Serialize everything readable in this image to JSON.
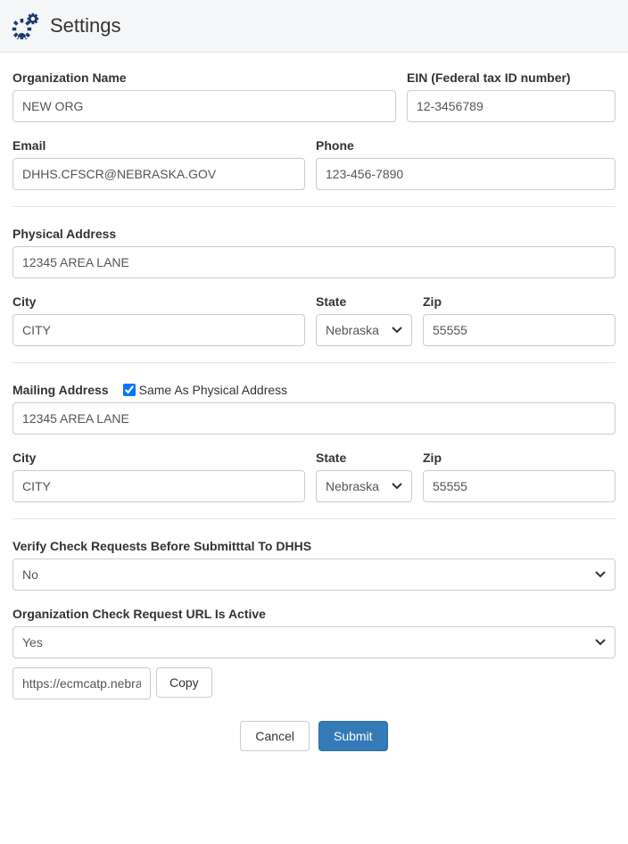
{
  "header": {
    "title": "Settings",
    "icon": "gears-icon"
  },
  "fields": {
    "org_name": {
      "label": "Organization Name",
      "value": "NEW ORG"
    },
    "ein": {
      "label": "EIN (Federal tax ID number)",
      "value": "12-3456789"
    },
    "email": {
      "label": "Email",
      "value": "DHHS.CFSCR@NEBRASKA.GOV"
    },
    "phone": {
      "label": "Phone",
      "value": "123-456-7890"
    },
    "physical_address": {
      "label": "Physical Address",
      "value": "12345 AREA LANE"
    },
    "phys_city": {
      "label": "City",
      "value": "CITY"
    },
    "phys_state": {
      "label": "State",
      "value": "Nebraska"
    },
    "phys_zip": {
      "label": "Zip",
      "value": "55555"
    },
    "mailing_address": {
      "label": "Mailing Address",
      "value": "12345 AREA LANE"
    },
    "same_as_physical": {
      "label": "Same As Physical Address",
      "checked": true
    },
    "mail_city": {
      "label": "City",
      "value": "CITY"
    },
    "mail_state": {
      "label": "State",
      "value": "Nebraska"
    },
    "mail_zip": {
      "label": "Zip",
      "value": "55555"
    },
    "verify_check": {
      "label": "Verify Check Requests Before Submitttal To DHHS",
      "value": "No"
    },
    "url_active": {
      "label": "Organization Check Request URL Is Active",
      "value": "Yes"
    },
    "url": {
      "value": "https://ecmcatp.nebraska"
    },
    "copy_btn": "Copy"
  },
  "actions": {
    "cancel": "Cancel",
    "submit": "Submit"
  }
}
